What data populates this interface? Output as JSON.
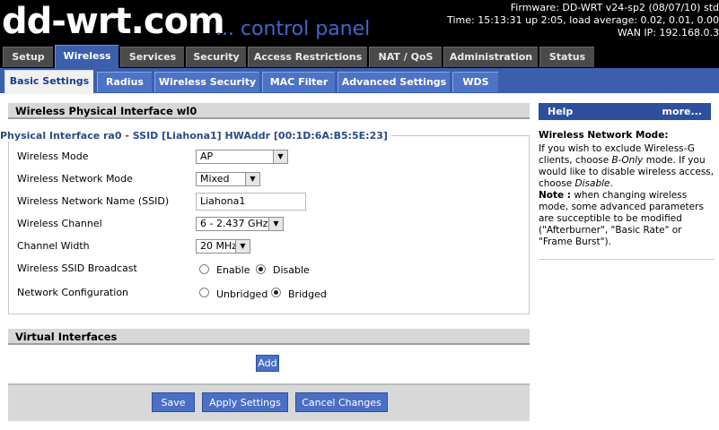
{
  "header": {
    "logo_main": "dd-wrt.com",
    "logo_sub": "... control panel",
    "firmware": "Firmware: DD-WRT v24-sp2 (08/07/10) std",
    "time": "Time: 15:13:31 up 2:05, load average: 0.02, 0.01, 0.00",
    "wan_ip": "WAN IP: 192.168.0.3"
  },
  "main_tabs": [
    "Setup",
    "Wireless",
    "Services",
    "Security",
    "Access Restrictions",
    "NAT / QoS",
    "Administration",
    "Status"
  ],
  "sub_tabs": [
    "Basic Settings",
    "Radius",
    "Wireless Security",
    "MAC Filter",
    "Advanced Settings",
    "WDS"
  ],
  "section": {
    "physical_title": "Wireless Physical Interface wl0",
    "legend": "Physical Interface ra0 - SSID [Liahona1] HWAddr [00:1D:6A:B5:5E:23]",
    "virtual_title": "Virtual Interfaces"
  },
  "form": {
    "wireless_mode_label": "Wireless Mode",
    "wireless_mode_value": "AP",
    "network_mode_label": "Wireless Network Mode",
    "network_mode_value": "Mixed",
    "ssid_label": "Wireless Network Name (SSID)",
    "ssid_value": "Liahona1",
    "channel_label": "Wireless Channel",
    "channel_value": "6 - 2.437 GHz",
    "width_label": "Channel Width",
    "width_value": "20 MHz",
    "broadcast_label": "Wireless SSID Broadcast",
    "enable_label": "Enable",
    "disable_label": "Disable",
    "netconfig_label": "Network Configuration",
    "unbridged_label": "Unbridged",
    "bridged_label": "Bridged"
  },
  "buttons": {
    "add": "Add",
    "save": "Save",
    "apply": "Apply Settings",
    "cancel": "Cancel Changes"
  },
  "help": {
    "title": "Help",
    "more": "more...",
    "heading": "Wireless Network Mode:",
    "p1_a": "If you wish to exclude Wireless-G clients, choose ",
    "p1_em": "B-Only",
    "p1_b": " mode. If you would like to disable wireless access, choose ",
    "p1_em2": "Disable",
    "p1_c": ".",
    "note_label": "Note :",
    "note_text": " when changing wireless mode, some advanced parameters are succeptible to be modified (\"Afterburner\", \"Basic Rate\" or \"Frame Burst\")."
  },
  "colors": {
    "header_bg": "#000000",
    "active_main_tab": "#3b5fad",
    "sub_tab_bar": "#3b5fad",
    "button": "#4a6fc4",
    "logo_accent": "#3d69c8"
  }
}
